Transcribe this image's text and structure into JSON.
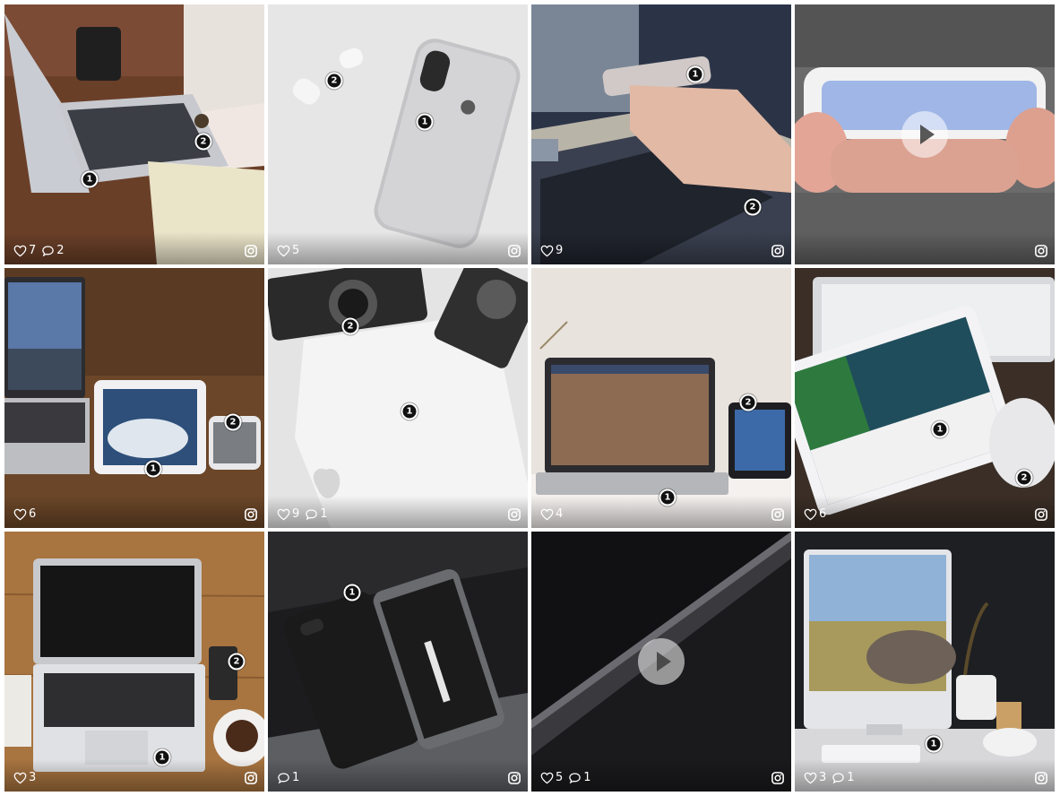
{
  "feed": {
    "posts": [
      {
        "subject": "laptop-on-desk",
        "likes": "7",
        "comments": "2",
        "hotspots": [
          "1",
          "2"
        ],
        "video": false
      },
      {
        "subject": "iphone-and-airpods",
        "likes": "5",
        "comments": "",
        "hotspots": [
          "1",
          "2"
        ],
        "video": false
      },
      {
        "subject": "phone-over-laptop",
        "likes": "9",
        "comments": "",
        "hotspots": [
          "1",
          "2"
        ],
        "video": false
      },
      {
        "subject": "phone-in-hands",
        "likes": "",
        "comments": "",
        "hotspots": [],
        "video": true
      },
      {
        "subject": "macbook-ipad-iphone",
        "likes": "6",
        "comments": "",
        "hotspots": [
          "1",
          "2"
        ],
        "video": false
      },
      {
        "subject": "vintage-cameras",
        "likes": "9",
        "comments": "1",
        "hotspots": [
          "1",
          "2"
        ],
        "video": false
      },
      {
        "subject": "laptop-and-tablet-workspace",
        "likes": "4",
        "comments": "",
        "hotspots": [
          "1",
          "2"
        ],
        "video": false
      },
      {
        "subject": "ipad-with-keyboard",
        "likes": "6",
        "comments": "",
        "hotspots": [
          "1",
          "2"
        ],
        "video": false
      },
      {
        "subject": "macbook-air-desk",
        "likes": "3",
        "comments": "",
        "hotspots": [
          "1",
          "2"
        ],
        "video": false
      },
      {
        "subject": "black-smartphones",
        "likes": "",
        "comments": "1",
        "hotspots": [
          "1"
        ],
        "video": false
      },
      {
        "subject": "dark-abstract",
        "likes": "5",
        "comments": "1",
        "hotspots": [],
        "video": true
      },
      {
        "subject": "imac-elephant",
        "likes": "3",
        "comments": "1",
        "hotspots": [
          "1"
        ],
        "video": false
      }
    ]
  },
  "icons": {
    "like": "heart-outline",
    "comment": "speech-bubble-outline",
    "source": "instagram-glyph",
    "video": "play-circle"
  },
  "colors": {
    "hotspot_fill": "#111111",
    "hotspot_ring": "#ffffff",
    "overlay_text": "#ffffff"
  }
}
